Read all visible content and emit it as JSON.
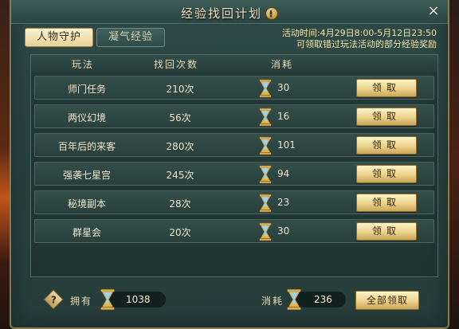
{
  "window": {
    "title": "经验找回计划",
    "close_label": "×",
    "info_icon": "!"
  },
  "tabs": [
    {
      "label": "人物守护",
      "active": true
    },
    {
      "label": "凝气经验",
      "active": false
    }
  ],
  "event": {
    "time": "活动时间:4月29日8:00-5月12日23:50",
    "desc": "可领取错过玩法活动的部分经验奖励"
  },
  "table": {
    "headers": {
      "name": "玩法",
      "count": "找回次数",
      "cost": "消耗"
    },
    "rows": [
      {
        "name": "师门任务",
        "count": "210次",
        "cost": "30",
        "button": "领取"
      },
      {
        "name": "两仪幻境",
        "count": "56次",
        "cost": "16",
        "button": "领取"
      },
      {
        "name": "百年后的来客",
        "count": "280次",
        "cost": "101",
        "button": "领取"
      },
      {
        "name": "强袭七星宫",
        "count": "245次",
        "cost": "94",
        "button": "领取"
      },
      {
        "name": "秘境副本",
        "count": "28次",
        "cost": "23",
        "button": "领取"
      },
      {
        "name": "群星会",
        "count": "20次",
        "cost": "30",
        "button": "领取"
      }
    ]
  },
  "footer": {
    "help_icon": "?",
    "own_label": "拥有",
    "own_value": "1038",
    "cost_label": "消耗",
    "cost_value": "236",
    "claim_all": "全部领取"
  },
  "colors": {
    "panel": "#2a4340",
    "accent_gold": "#ecd28c",
    "text_yellow": "#f4e6a8"
  },
  "icons": {
    "currency": "hourglass-icon"
  }
}
